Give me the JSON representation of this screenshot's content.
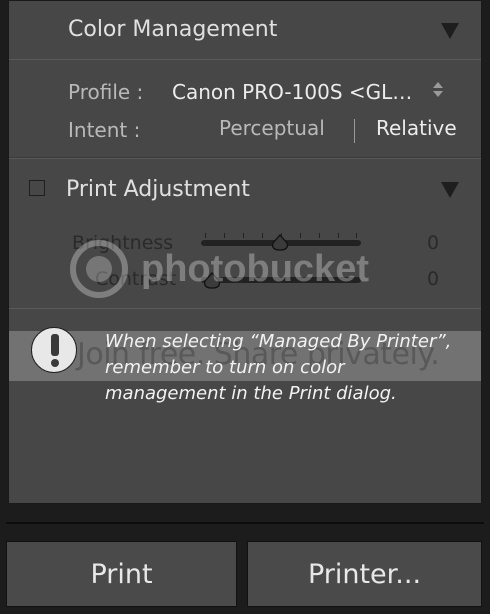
{
  "color_management": {
    "title": "Color Management",
    "profile_label": "Profile :",
    "profile_value": "Canon PRO-100S <GL…",
    "intent_label": "Intent :",
    "intent_options": [
      "Perceptual",
      "Relative"
    ],
    "intent_selected": "Relative"
  },
  "print_adjustment": {
    "title": "Print Adjustment",
    "checked": false,
    "brightness_label": "Brightness",
    "brightness_value": "0",
    "contrast_label": "Contrast",
    "contrast_value": "0"
  },
  "notice": {
    "text": "When selecting “Managed By Printer”, remember to turn on color management in the Print dialog.",
    "icon": "warning-icon"
  },
  "watermark": {
    "brand": "photobucket",
    "tagline": "Join free. Share privately."
  },
  "buttons": {
    "print": "Print",
    "printer": "Printer..."
  },
  "colors": {
    "panel_bg": "#474747",
    "page_bg": "#1c1c1c",
    "selected_text": "#ececec",
    "label_text": "#b9b9b9"
  }
}
